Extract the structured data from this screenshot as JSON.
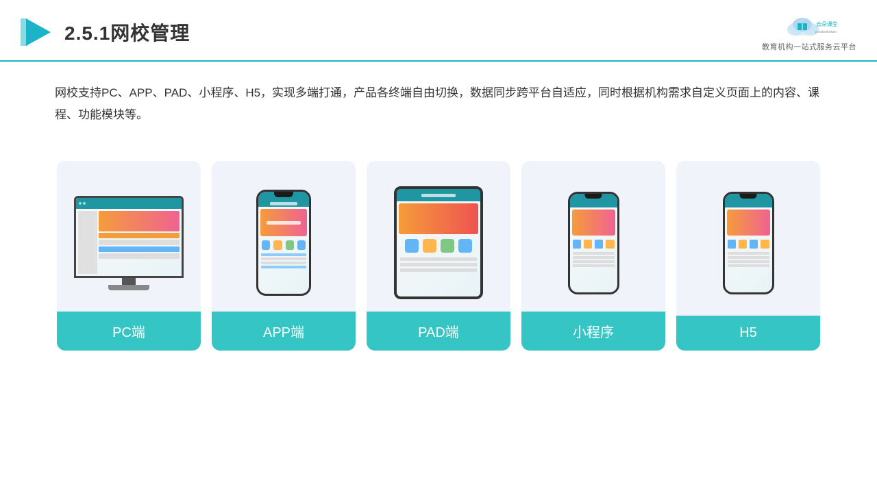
{
  "header": {
    "title": "2.5.1网校管理",
    "logo_name": "云朵课堂",
    "logo_url": "yunduoketang.com",
    "logo_subtitle": "教育机构一站式服务云平台"
  },
  "description": {
    "text": "网校支持PC、APP、PAD、小程序、H5，实现多端打通，产品各终端自由切换，数据同步跨平台自适应，同时根据机构需求自定义页面上的内容、课程、功能模块等。"
  },
  "cards": [
    {
      "label": "PC端",
      "device": "pc"
    },
    {
      "label": "APP端",
      "device": "phone"
    },
    {
      "label": "PAD端",
      "device": "tablet"
    },
    {
      "label": "小程序",
      "device": "mini-phone"
    },
    {
      "label": "H5",
      "device": "mini-phone"
    }
  ],
  "colors": {
    "accent": "#36c5c5",
    "header_line": "#1ab3c8",
    "card_bg": "#f0f4fa",
    "text_main": "#333333"
  }
}
